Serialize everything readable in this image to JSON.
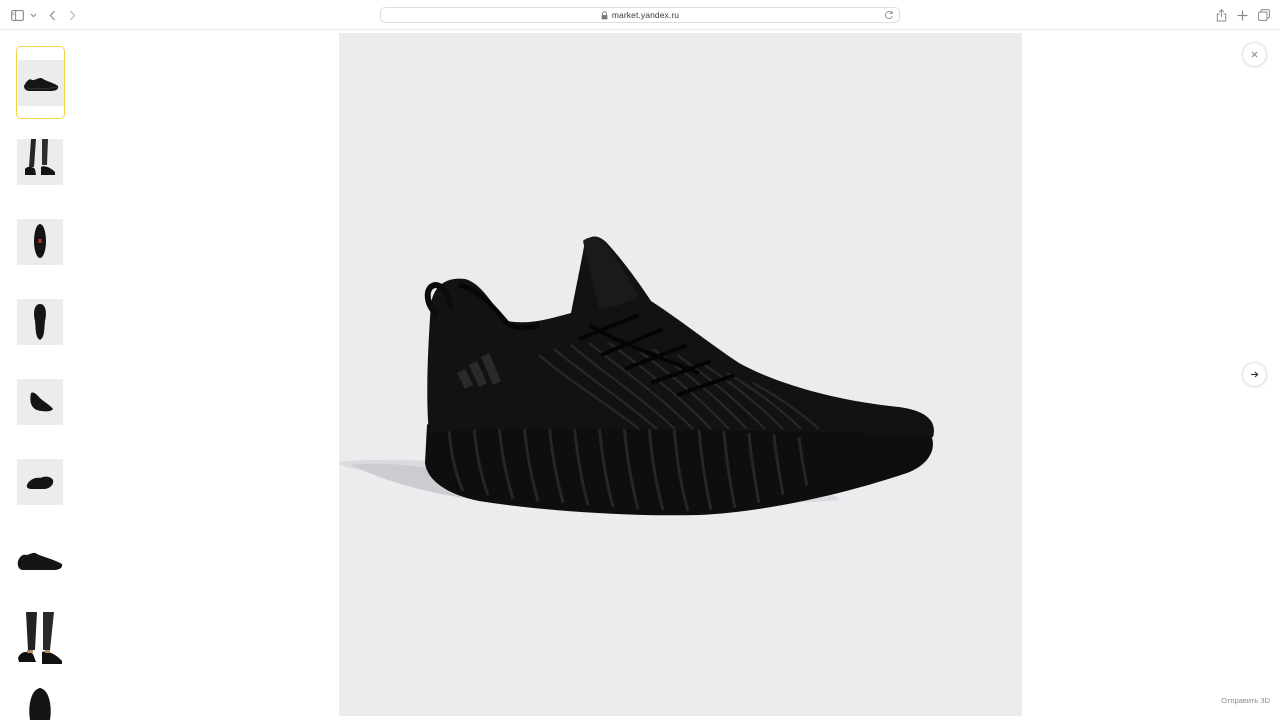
{
  "browser": {
    "url": "market.yandex.ru"
  },
  "viewer": {
    "thumbnails": [
      {
        "view": "side",
        "selected": true
      },
      {
        "view": "worn-legs",
        "selected": false
      },
      {
        "view": "top",
        "selected": false
      },
      {
        "view": "sole",
        "selected": false
      },
      {
        "view": "front-three-quarter",
        "selected": false
      },
      {
        "view": "back-three-quarter",
        "selected": false
      },
      {
        "view": "side-plain",
        "selected": false
      },
      {
        "view": "worn-legs-2",
        "selected": false
      },
      {
        "view": "heel",
        "selected": false
      }
    ],
    "selected_index": 0,
    "main_image": "black adidas running sneaker, side view",
    "send_3d_label": "Отправить 3D"
  },
  "colors": {
    "selection_border": "#f3d54c",
    "image_background": "#ebecee"
  },
  "icons": {
    "close": "close-icon",
    "next": "arrow-right-icon",
    "lock": "lock-icon",
    "reload": "reload-icon"
  }
}
